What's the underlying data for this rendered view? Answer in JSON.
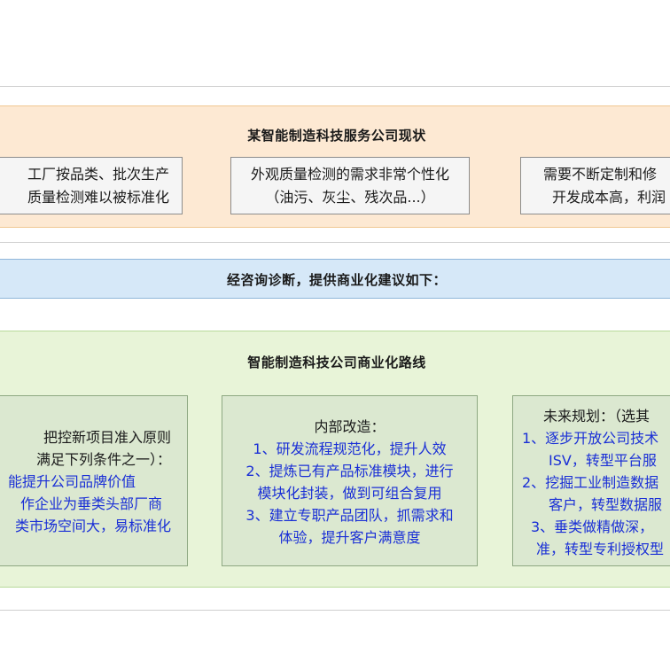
{
  "status": {
    "title": "某智能制造科技服务公司现状",
    "cards": [
      {
        "lines": [
          "工厂按品类、批次生产",
          "质量检测难以被标准化"
        ]
      },
      {
        "lines": [
          "外观质量检测的需求非常个性化",
          "（油污、灰尘、残次品...）"
        ]
      },
      {
        "lines": [
          "需要不断定制和修",
          "开发成本高，利润"
        ]
      }
    ]
  },
  "advice": {
    "title": "经咨询诊断，提供商业化建议如下："
  },
  "route": {
    "title": "智能制造科技公司商业化路线",
    "cards": [
      {
        "heading": [
          "把控新项目准入原则",
          "满足下列条件之一）："
        ],
        "items": [
          "能提升公司品牌价值",
          "作企业为垂类头部厂商",
          "类市场空间大，易标准化"
        ]
      },
      {
        "heading": [
          "内部改造："
        ],
        "items": [
          "1、研发流程规范化，提升人效",
          "2、提炼已有产品标准模块，进行",
          "模块化封装，做到可组合复用",
          "3、建立专职产品团队，抓需求和",
          "体验，提升客户满意度"
        ]
      },
      {
        "heading": [
          "未来规划：（选其"
        ],
        "items": [
          "1、逐步开放公司技术",
          "ISV，转型平台服",
          "2、挖掘工业制造数据",
          "客户，转型数据服",
          "3、垂类做精做深，",
          "准，转型专利授权型"
        ]
      }
    ]
  }
}
